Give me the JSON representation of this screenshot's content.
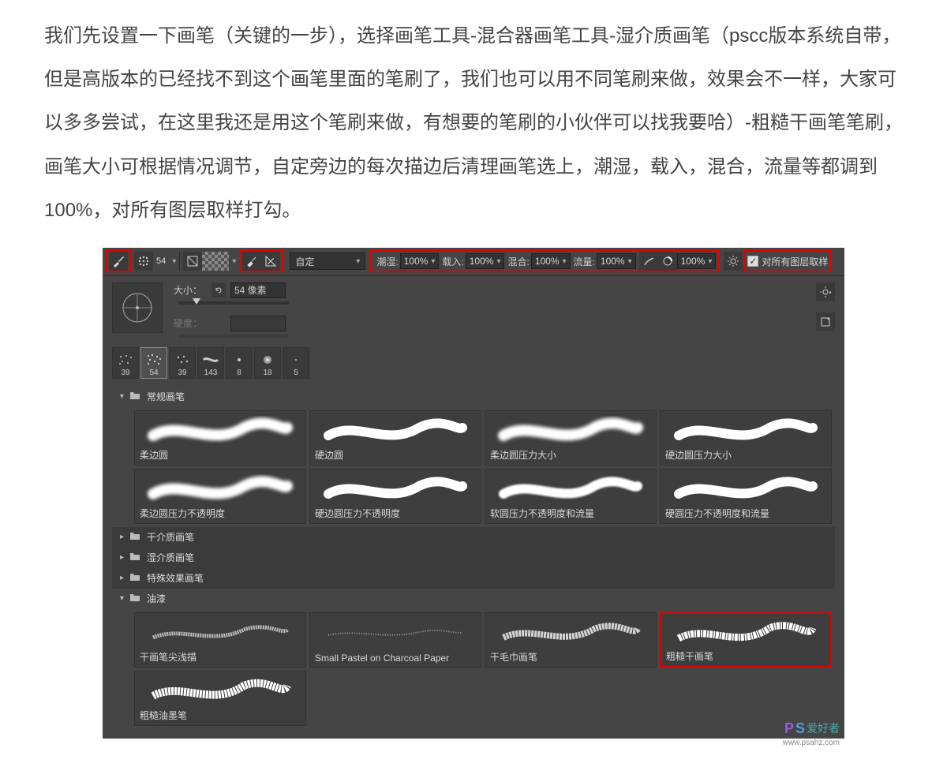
{
  "article": {
    "text": "我们先设置一下画笔（关键的一步），选择画笔工具-混合器画笔工具-湿介质画笔（pscc版本系统自带，但是高版本的已经找不到这个画笔里面的笔刷了，我们也可以用不同笔刷来做，效果会不一样，大家可以多多尝试，在这里我还是用这个笔刷来做，有想要的笔刷的小伙伴可以找我要哈）-粗糙干画笔笔刷，画笔大小可根据情况调节，自定旁边的每次描边后清理画笔选上，潮湿，载入，混合，流量等都调到100%，对所有图层取样打勾。"
  },
  "optbar": {
    "brush_num": "54",
    "preset_label": "自定",
    "wet_label": "潮湿:",
    "wet_val": "100%",
    "load_label": "载入:",
    "load_val": "100%",
    "mix_label": "混合:",
    "mix_val": "100%",
    "flow_label": "流量:",
    "flow_val": "100%",
    "extra_val": "100%",
    "sample_all_label": "对所有图层取样"
  },
  "panel": {
    "size_label": "大小：",
    "size_value": "54 像素",
    "hardness_label": "硬度：",
    "thumbs": [
      {
        "num": "39"
      },
      {
        "num": "54"
      },
      {
        "num": "39"
      },
      {
        "num": "143"
      },
      {
        "num": "8"
      },
      {
        "num": "18"
      },
      {
        "num": "5"
      }
    ],
    "folders": {
      "regular": "常规画笔",
      "dry": "干介质画笔",
      "wet": "湿介质画笔",
      "special": "特殊效果画笔",
      "oil": "油漆"
    },
    "regular_brushes": [
      "柔边圆",
      "硬边圆",
      "柔边圆压力大小",
      "硬边圆压力大小",
      "柔边圆压力不透明度",
      "硬边圆压力不透明度",
      "软圆压力不透明度和流量",
      "硬圆压力不透明度和流量"
    ],
    "oil_brushes": [
      "干画笔尖浅描",
      "Small Pastel on Charcoal Paper",
      "干毛巾画笔",
      "粗糙干画笔",
      "粗糙油墨笔"
    ]
  },
  "watermark": {
    "cn": "爱好者",
    "url": "www.psahz.com"
  }
}
